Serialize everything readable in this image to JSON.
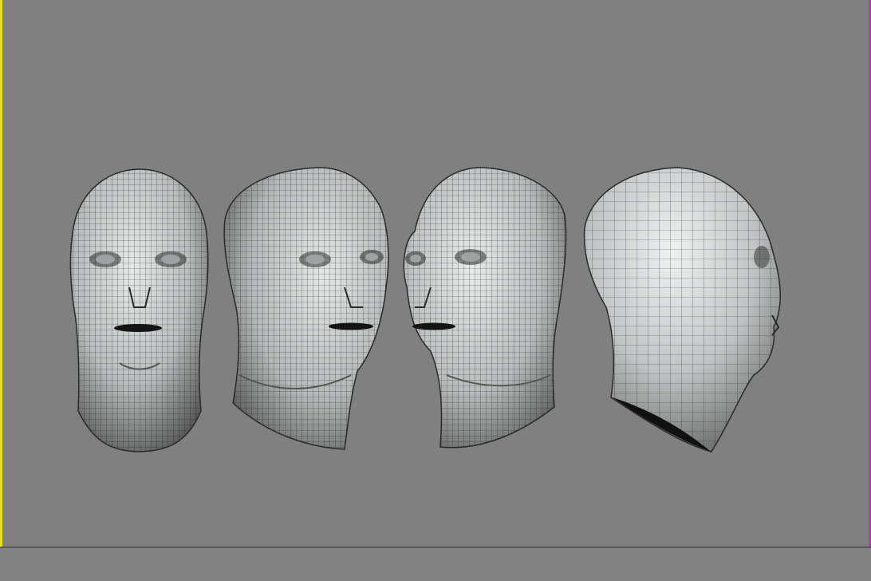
{
  "scene": {
    "background": "#808080",
    "viewport_edges": {
      "left_color": "#e6dc2a",
      "right_color": "#c52fc6",
      "divider_color": "#2a2a2a"
    },
    "models": [
      {
        "name": "head-front-view",
        "view": "front"
      },
      {
        "name": "head-three-quarter-left-view",
        "view": "three-quarter-left"
      },
      {
        "name": "head-three-quarter-right-view",
        "view": "three-quarter-right"
      },
      {
        "name": "head-side-back-view",
        "view": "side-back"
      }
    ],
    "mesh": {
      "surface_color": "#c9cccc",
      "shadow_color": "#3d3d3d",
      "wire_color": "#1e1e1e"
    }
  }
}
